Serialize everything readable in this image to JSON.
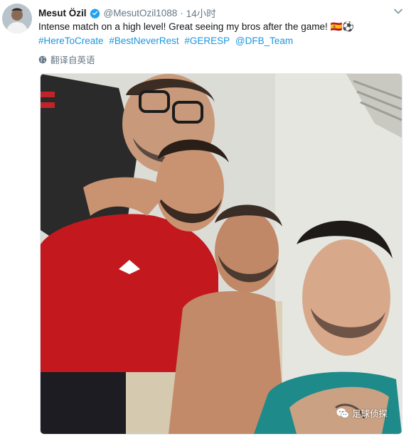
{
  "tweet": {
    "author_name": "Mesut Özil",
    "handle": "@MesutOzil1088",
    "separator": "·",
    "time": "14小时",
    "text": "Intense match on a high level! Great seeing my bros after the game! 🇪🇸⚽",
    "hashtags": [
      "#HereToCreate",
      "#BestNeverRest",
      "#GERESP",
      "@DFB_Team"
    ],
    "translate_label": "翻译自英语"
  },
  "watermark": {
    "label": "足球侦探"
  },
  "icons": {
    "avatar": "avatar",
    "verified": "verified-badge-icon",
    "caret": "chevron-down-icon",
    "globe": "globe-icon",
    "wechat": "wechat-icon"
  },
  "colors": {
    "link": "#1b95e0",
    "secondary_text": "#657786",
    "verified": "#1da1f2"
  }
}
